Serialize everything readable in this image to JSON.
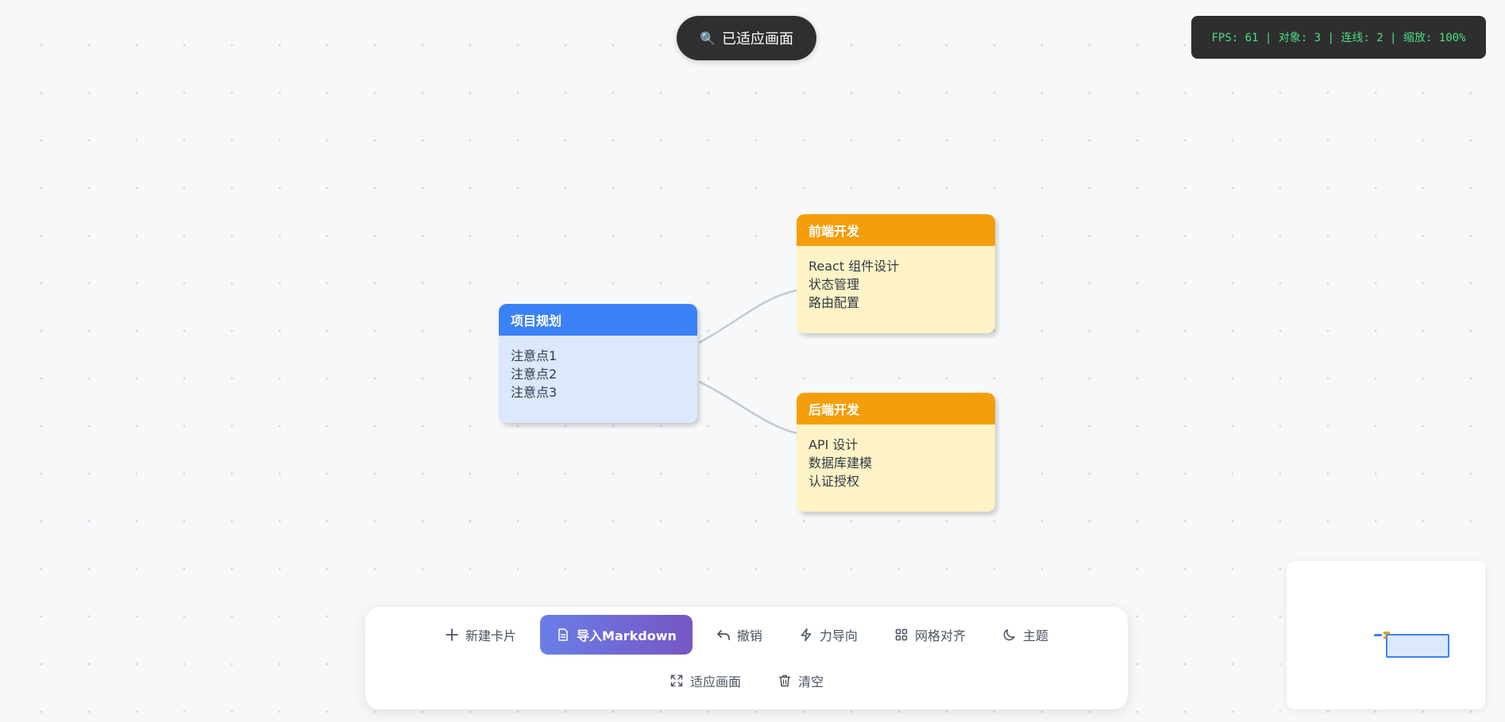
{
  "toast": {
    "icon": "🔍",
    "icon_name": "magnifier-icon",
    "text": "已适应画面"
  },
  "stats": {
    "text": "FPS: 61 | 对象: 3 | 连线: 2 | 缩放: 100%"
  },
  "cards": {
    "root": {
      "title": "项目规划",
      "lines": [
        "注意点1",
        "注意点2",
        "注意点3"
      ],
      "color": "#3b82f6"
    },
    "frontend": {
      "title": "前端开发",
      "lines": [
        "React 组件设计",
        "状态管理",
        "路由配置"
      ],
      "color": "#f59e0b"
    },
    "backend": {
      "title": "后端开发",
      "lines": [
        "API 设计",
        "数据库建模",
        "认证授权"
      ],
      "color": "#f59e0b"
    }
  },
  "toolbar": {
    "new_card": "新建卡片",
    "import_markdown": "导入Markdown",
    "undo": "撤销",
    "force_layout": "力导向",
    "grid_align": "网格对齐",
    "theme": "主题",
    "fit_view": "适应画面",
    "clear": "清空"
  },
  "colors": {
    "accent_blue": "#3b82f6",
    "accent_amber": "#f59e0b",
    "primary_gradient_start": "#6a7ee8",
    "primary_gradient_end": "#7656c4",
    "stats_text": "#4ade80"
  }
}
